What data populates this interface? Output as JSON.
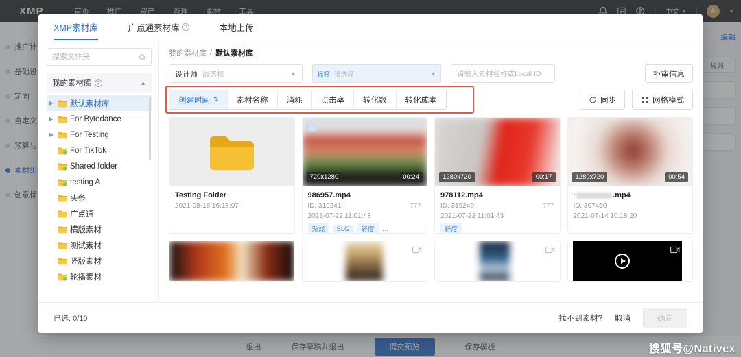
{
  "background": {
    "logo": "XMP",
    "nav": [
      "首页",
      "推广",
      "资产",
      "管理",
      "素材",
      "工具"
    ],
    "language": "中文",
    "avatar_letter": "A",
    "icons": {
      "bell": "bell-icon",
      "list": "list-icon",
      "help": "help-icon"
    },
    "steps": [
      {
        "label": "推广计..."
      },
      {
        "label": "基础设..."
      },
      {
        "label": "定向"
      },
      {
        "label": "自定义..."
      },
      {
        "label": "预算与..."
      },
      {
        "label": "素材组",
        "active": true
      },
      {
        "label": "创意标..."
      }
    ],
    "right_panel": {
      "edit": "编辑",
      "chip": "规则"
    },
    "bottom_buttons": [
      "退出",
      "保存草稿并退出",
      "提交预览",
      "保存模板"
    ],
    "primary_button": "提交预览"
  },
  "modal": {
    "tabs": [
      {
        "label": "XMP素材库",
        "active": true,
        "help": false
      },
      {
        "label": "广点通素材库",
        "active": false,
        "help": true
      },
      {
        "label": "本地上传",
        "active": false,
        "help": false
      }
    ],
    "sidebar": {
      "search_placeholder": "搜索文件夹",
      "library_title": "我的素材库",
      "tree": [
        {
          "label": "默认素材库",
          "expandable": true,
          "selected": true,
          "shared": false
        },
        {
          "label": "For Bytedance",
          "expandable": true,
          "selected": false,
          "shared": false
        },
        {
          "label": "For Testing",
          "expandable": true,
          "selected": false,
          "shared": false
        },
        {
          "label": "For TikTok",
          "expandable": false,
          "selected": false,
          "shared": true
        },
        {
          "label": "Shared folder",
          "expandable": false,
          "selected": false,
          "shared": true
        },
        {
          "label": "testing A",
          "expandable": false,
          "selected": false,
          "shared": true
        },
        {
          "label": "头条",
          "expandable": false,
          "selected": false,
          "shared": false
        },
        {
          "label": "广点通",
          "expandable": false,
          "selected": false,
          "shared": false
        },
        {
          "label": "横版素材",
          "expandable": false,
          "selected": false,
          "shared": false
        },
        {
          "label": "测试素材",
          "expandable": false,
          "selected": false,
          "shared": false
        },
        {
          "label": "竖版素材",
          "expandable": false,
          "selected": false,
          "shared": false
        },
        {
          "label": "轮播素材",
          "expandable": false,
          "selected": false,
          "shared": true
        }
      ]
    },
    "breadcrumb": {
      "root": "我的素材库",
      "sep": "/",
      "current": "默认素材库"
    },
    "filters": {
      "designer_label": "设计师",
      "designer_value": "请选择",
      "tag_label": "标签",
      "tag_value": "请选择",
      "search_placeholder": "请输入素材名称或Local ID",
      "reject_button": "拒审信息"
    },
    "sort": {
      "items": [
        {
          "label": "创建时间",
          "active": true,
          "has_icon": true
        },
        {
          "label": "素材名称",
          "active": false,
          "has_icon": false
        },
        {
          "label": "消耗",
          "active": false,
          "has_icon": false
        },
        {
          "label": "点击率",
          "active": false,
          "has_icon": false
        },
        {
          "label": "转化数",
          "active": false,
          "has_icon": false
        },
        {
          "label": "转化成本",
          "active": false,
          "has_icon": false
        }
      ],
      "sync_button": "同步",
      "view_button": "网格模式"
    },
    "cards": [
      {
        "type": "folder",
        "name": "Testing Folder",
        "date": "2021-08-18 16:18:07"
      },
      {
        "type": "video",
        "dimension": "720x1280",
        "duration": "00:24",
        "name": "986957.mp4",
        "id": "ID: 319241",
        "count": "777",
        "date": "2021-07-22 11:01:43",
        "tags": [
          "游戏",
          "SLG",
          "轻度"
        ],
        "tag_more": "…",
        "checked": true
      },
      {
        "type": "video",
        "dimension": "1280x720",
        "duration": "00:17",
        "name": "978112.mp4",
        "id": "ID: 319240",
        "count": "777",
        "date": "2021-07-22 11:01:43",
        "tags": [
          "轻度"
        ],
        "tag_more": "",
        "checked": false
      },
      {
        "type": "video",
        "dimension": "1280x720",
        "duration": "00:54",
        "name_prefix": "·",
        "name_suffix": ".mp4",
        "redacted": true,
        "id": "ID: 307460",
        "count": "",
        "date": "2021-07-14 10:18:20",
        "tags": [],
        "tag_more": "",
        "checked": false
      }
    ],
    "footer": {
      "selected": "已选: 0/10",
      "not_found": "找不到素材?",
      "cancel": "取消",
      "confirm": "确定"
    }
  },
  "watermark": "搜狐号@Nativex",
  "colors": {
    "accent": "#2c6ecb",
    "highlight_box": "#e05a47",
    "folder": "#f0b429",
    "tag_text": "#4a8fd8"
  }
}
